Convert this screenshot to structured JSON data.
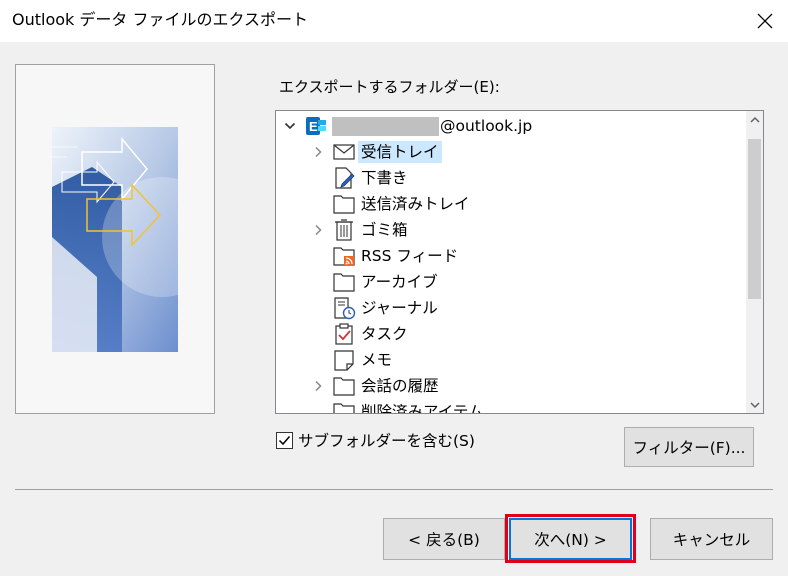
{
  "window": {
    "title": "Outlook データ ファイルのエクスポート",
    "close_icon": "close-icon"
  },
  "folder_section": {
    "label": "エクスポートするフォルダー(E):"
  },
  "tree": {
    "account": {
      "email_suffix": "@outlook.jp",
      "icon": "exchange-account-icon",
      "expanded": true
    },
    "items": [
      {
        "label": "受信トレイ",
        "icon": "inbox-icon",
        "expandable": true,
        "selected": true
      },
      {
        "label": "下書き",
        "icon": "drafts-icon",
        "expandable": false
      },
      {
        "label": "送信済みトレイ",
        "icon": "folder-icon",
        "expandable": false
      },
      {
        "label": "ゴミ箱",
        "icon": "trash-icon",
        "expandable": true
      },
      {
        "label": "RSS フィード",
        "icon": "rss-folder-icon",
        "expandable": false
      },
      {
        "label": "アーカイブ",
        "icon": "folder-icon",
        "expandable": false
      },
      {
        "label": "ジャーナル",
        "icon": "journal-icon",
        "expandable": false
      },
      {
        "label": "タスク",
        "icon": "tasks-icon",
        "expandable": false
      },
      {
        "label": "メモ",
        "icon": "notes-icon",
        "expandable": false
      },
      {
        "label": "会話の履歴",
        "icon": "folder-icon",
        "expandable": true
      },
      {
        "label": "削除済みアイテム",
        "icon": "folder-icon",
        "expandable": false
      }
    ]
  },
  "options": {
    "include_subfolders_label": "サブフォルダーを含む(S)",
    "include_subfolders_checked": true,
    "filter_button": "フィルター(F)..."
  },
  "footer": {
    "back_button": "< 戻る(B)",
    "next_button": "次へ(N) >",
    "cancel_button": "キャンセル"
  },
  "colors": {
    "selection": "#cce8ff",
    "default_button_border": "#0078d7",
    "annotation_highlight": "#e0001a",
    "account_icon": "#0f6cbd"
  }
}
